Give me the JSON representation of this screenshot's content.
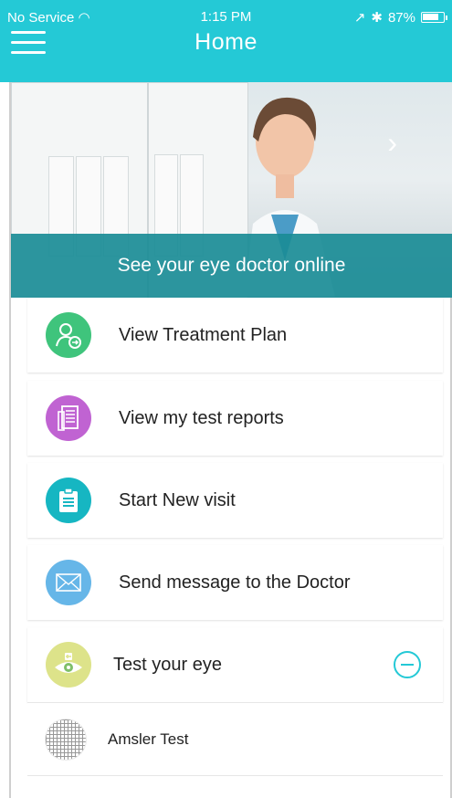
{
  "status_bar": {
    "carrier": "No Service",
    "time": "1:15 PM",
    "battery": "87%",
    "battery_level": 0.87
  },
  "header": {
    "title": "Home",
    "menu_icon": "hamburger-icon",
    "background": "#24c9d6"
  },
  "banner": {
    "caption": "See your eye doctor online",
    "next_icon": "chevron-right-icon"
  },
  "menu": {
    "items": [
      {
        "label": "View Treatment Plan",
        "icon": "user-arrow-icon",
        "color": "#3fc47c"
      },
      {
        "label": "View my test reports",
        "icon": "report-icon",
        "color": "#c063d2"
      },
      {
        "label": "Start New visit",
        "icon": "clipboard-icon",
        "color": "#16b6c2"
      },
      {
        "label": "Send message to the Doctor",
        "icon": "envelope-icon",
        "color": "#66b6e8"
      },
      {
        "label": "Test your eye",
        "icon": "eye-icon",
        "color": "#dde38a"
      }
    ],
    "sub_items": [
      {
        "label": "Amsler Test",
        "icon": "amsler-grid-icon"
      }
    ]
  }
}
